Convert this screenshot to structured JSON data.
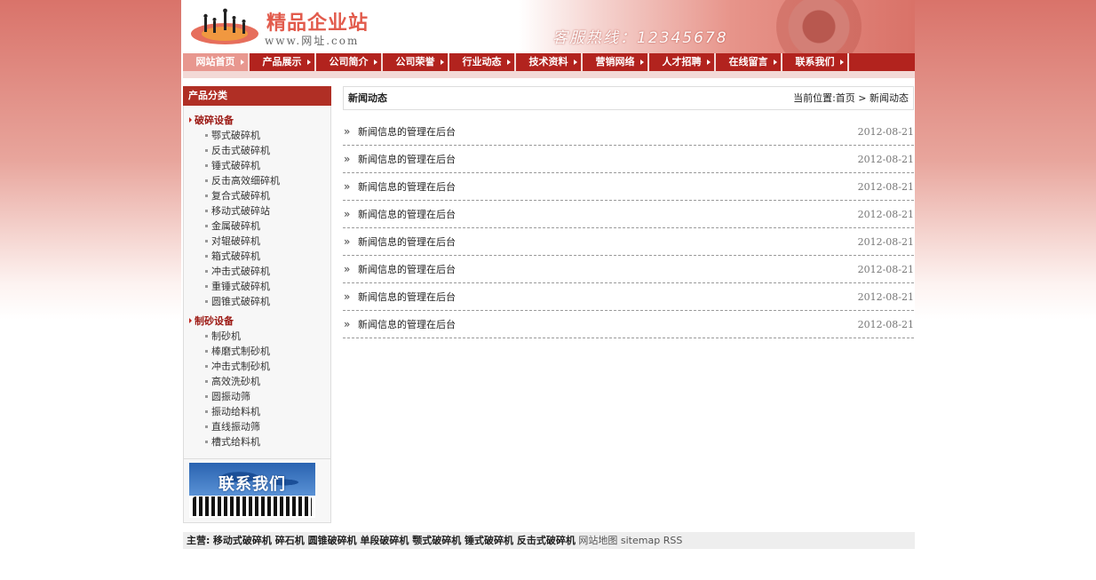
{
  "header": {
    "logo_title": "精品企业站",
    "logo_url": "www.网址.com",
    "hotline": "客服热线：12345678"
  },
  "nav": {
    "items": [
      {
        "label": "网站首页",
        "active": true
      },
      {
        "label": "产品展示",
        "active": false
      },
      {
        "label": "公司简介",
        "active": false
      },
      {
        "label": "公司荣誉",
        "active": false
      },
      {
        "label": "行业动态",
        "active": false
      },
      {
        "label": "技术资料",
        "active": false
      },
      {
        "label": "营销网络",
        "active": false
      },
      {
        "label": "人才招聘",
        "active": false
      },
      {
        "label": "在线留言",
        "active": false
      },
      {
        "label": "联系我们",
        "active": false
      }
    ]
  },
  "sidebar": {
    "title": "产品分类",
    "categories": [
      {
        "title": "破碎设备",
        "items": [
          "鄂式破碎机",
          "反击式破碎机",
          "锤式破碎机",
          "反击高效细碎机",
          "复合式破碎机",
          "移动式破碎站",
          "金属破碎机",
          "对辊破碎机",
          "箱式破碎机",
          "冲击式破碎机",
          "重锤式破碎机",
          "圆锥式破碎机"
        ]
      },
      {
        "title": "制砂设备",
        "items": [
          "制砂机",
          "棒磨式制砂机",
          "冲击式制砂机",
          "高效洗砂机",
          "圆振动筛",
          "振动给料机",
          "直线振动筛",
          "槽式给料机"
        ]
      }
    ],
    "contact_banner": "联系我们"
  },
  "main": {
    "title": "新闻动态",
    "breadcrumb": "当前位置:首页 > 新闻动态",
    "news": [
      {
        "title": "新闻信息的管理在后台",
        "date": "2012-08-21"
      },
      {
        "title": "新闻信息的管理在后台",
        "date": "2012-08-21"
      },
      {
        "title": "新闻信息的管理在后台",
        "date": "2012-08-21"
      },
      {
        "title": "新闻信息的管理在后台",
        "date": "2012-08-21"
      },
      {
        "title": "新闻信息的管理在后台",
        "date": "2012-08-21"
      },
      {
        "title": "新闻信息的管理在后台",
        "date": "2012-08-21"
      },
      {
        "title": "新闻信息的管理在后台",
        "date": "2012-08-21"
      },
      {
        "title": "新闻信息的管理在后台",
        "date": "2012-08-21"
      }
    ]
  },
  "footer": {
    "prefix": "主营:",
    "keywords": "移动式破碎机 碎石机 圆锥破碎机 单段破碎机 颚式破碎机 锤式破碎机 反击式破碎机",
    "sitemap": "网站地图",
    "sitemap_en": "sitemap",
    "rss": "RSS"
  },
  "colors": {
    "nav_bg": "#b2231e",
    "accent_red": "#9c1a14",
    "side_title_bg": "#b02f25"
  }
}
